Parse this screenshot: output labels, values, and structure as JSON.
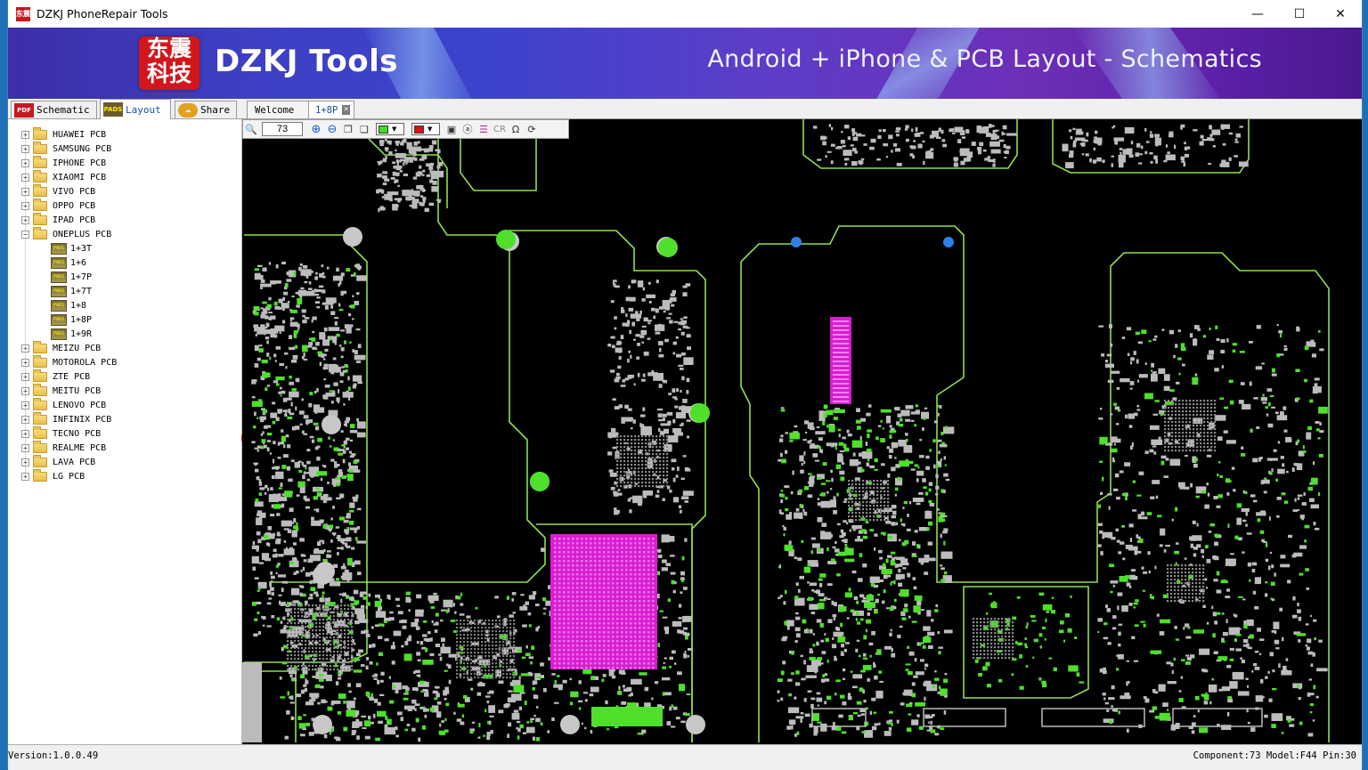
{
  "window": {
    "title": "DZKJ PhoneRepair Tools",
    "controls": {
      "minimize": "—",
      "maximize": "☐",
      "close": "✕"
    }
  },
  "banner": {
    "logo_chars": [
      "东",
      "震",
      "科",
      "技"
    ],
    "brand": "DZKJ Tools",
    "tagline": "Android + iPhone & PCB Layout - Schematics"
  },
  "mode_tabs": [
    {
      "icon": "PDF",
      "label": "Schematic"
    },
    {
      "icon": "PADS",
      "label": "Layout",
      "active": true
    },
    {
      "icon": "",
      "label": "Share"
    }
  ],
  "doc_tabs": [
    {
      "label": "Welcome"
    },
    {
      "label": "1+8P",
      "active": true
    }
  ],
  "toolbar": {
    "zoom": "73",
    "color1": "#44dd22",
    "color2": "#e01010",
    "cr_label": "CR",
    "ohm_label": "Ω"
  },
  "tree": {
    "folders": [
      "HUAWEI PCB",
      "SAMSUNG PCB",
      "IPHONE PCB",
      "XIAOMI PCB",
      "VIVO PCB",
      "OPPO PCB",
      "IPAD PCB",
      "ONEPLUS PCB"
    ],
    "expanded_index": 7,
    "children": [
      "1+3T",
      "1+6",
      "1+7P",
      "1+7T",
      "1+8",
      "1+8P",
      "1+9R"
    ],
    "folders_after": [
      "MEIZU PCB",
      "MOTOROLA PCB",
      "ZTE PCB",
      "MEITU PCB",
      "LENOVO PCB",
      "INFINIX PCB",
      "TECNO PCB",
      "REALME PCB",
      "LAVA PCB",
      "LG PCB"
    ],
    "pads_icon": "PADS"
  },
  "status": {
    "version": "Version:1.0.0.49",
    "info": "Component:73 Model:F44 Pin:30"
  },
  "colors": {
    "outline": "#8ee04a",
    "pad_green": "#4ee02a",
    "pad_gray": "#bcbcbc",
    "chip_magenta": "#d81ed0",
    "via_blue": "#2f7fe8"
  }
}
